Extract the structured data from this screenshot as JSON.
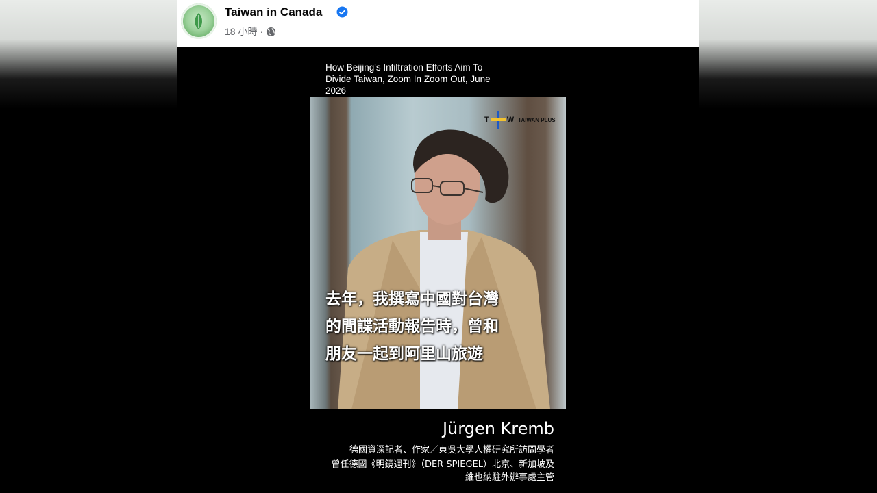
{
  "post": {
    "page_name": "Taiwan in Canada",
    "time": "18 小時",
    "separator": "·",
    "verified_icon": "verified-badge-icon",
    "audience_icon": "globe-icon"
  },
  "video": {
    "title": "How Beijing's Infiltration Efforts Aim To Divide Taiwan, Zoom In Zoom Out, June 2026",
    "logo": {
      "t": "T",
      "w": "W",
      "brand": "TAIWAN PLUS"
    },
    "subtitle_lines": [
      "去年，我撰寫中國對台灣",
      "的間諜活動報告時，曾和",
      "朋友一起到阿里山旅遊"
    ],
    "speaker_name": "Jürgen Kremb",
    "speaker_role": "德國資深記者、作家／東吳大學人權研究所訪問學者",
    "speaker_prev_1": "曾任德國《明鏡週刊》（DER SPIEGEL）北京、新加坡及",
    "speaker_prev_2": "維也納駐外辦事處主管"
  },
  "colors": {
    "verified": "#1877f2",
    "page_name": "#050505",
    "meta": "#65676b"
  }
}
